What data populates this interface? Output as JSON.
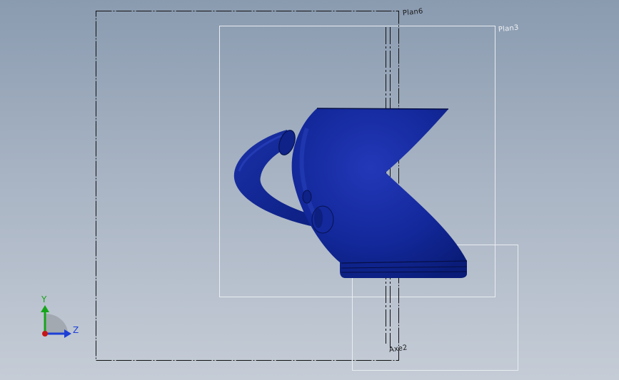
{
  "viewport": {
    "planes": {
      "front_plane_label": "Plan6",
      "right_plane_label": "Plan3"
    },
    "axis_label": "Axe2",
    "triad": {
      "y_label": "Y",
      "z_label": "Z",
      "y_color": "#16a51a",
      "z_color": "#1d3fd6"
    },
    "model_color": "#0c2490"
  }
}
